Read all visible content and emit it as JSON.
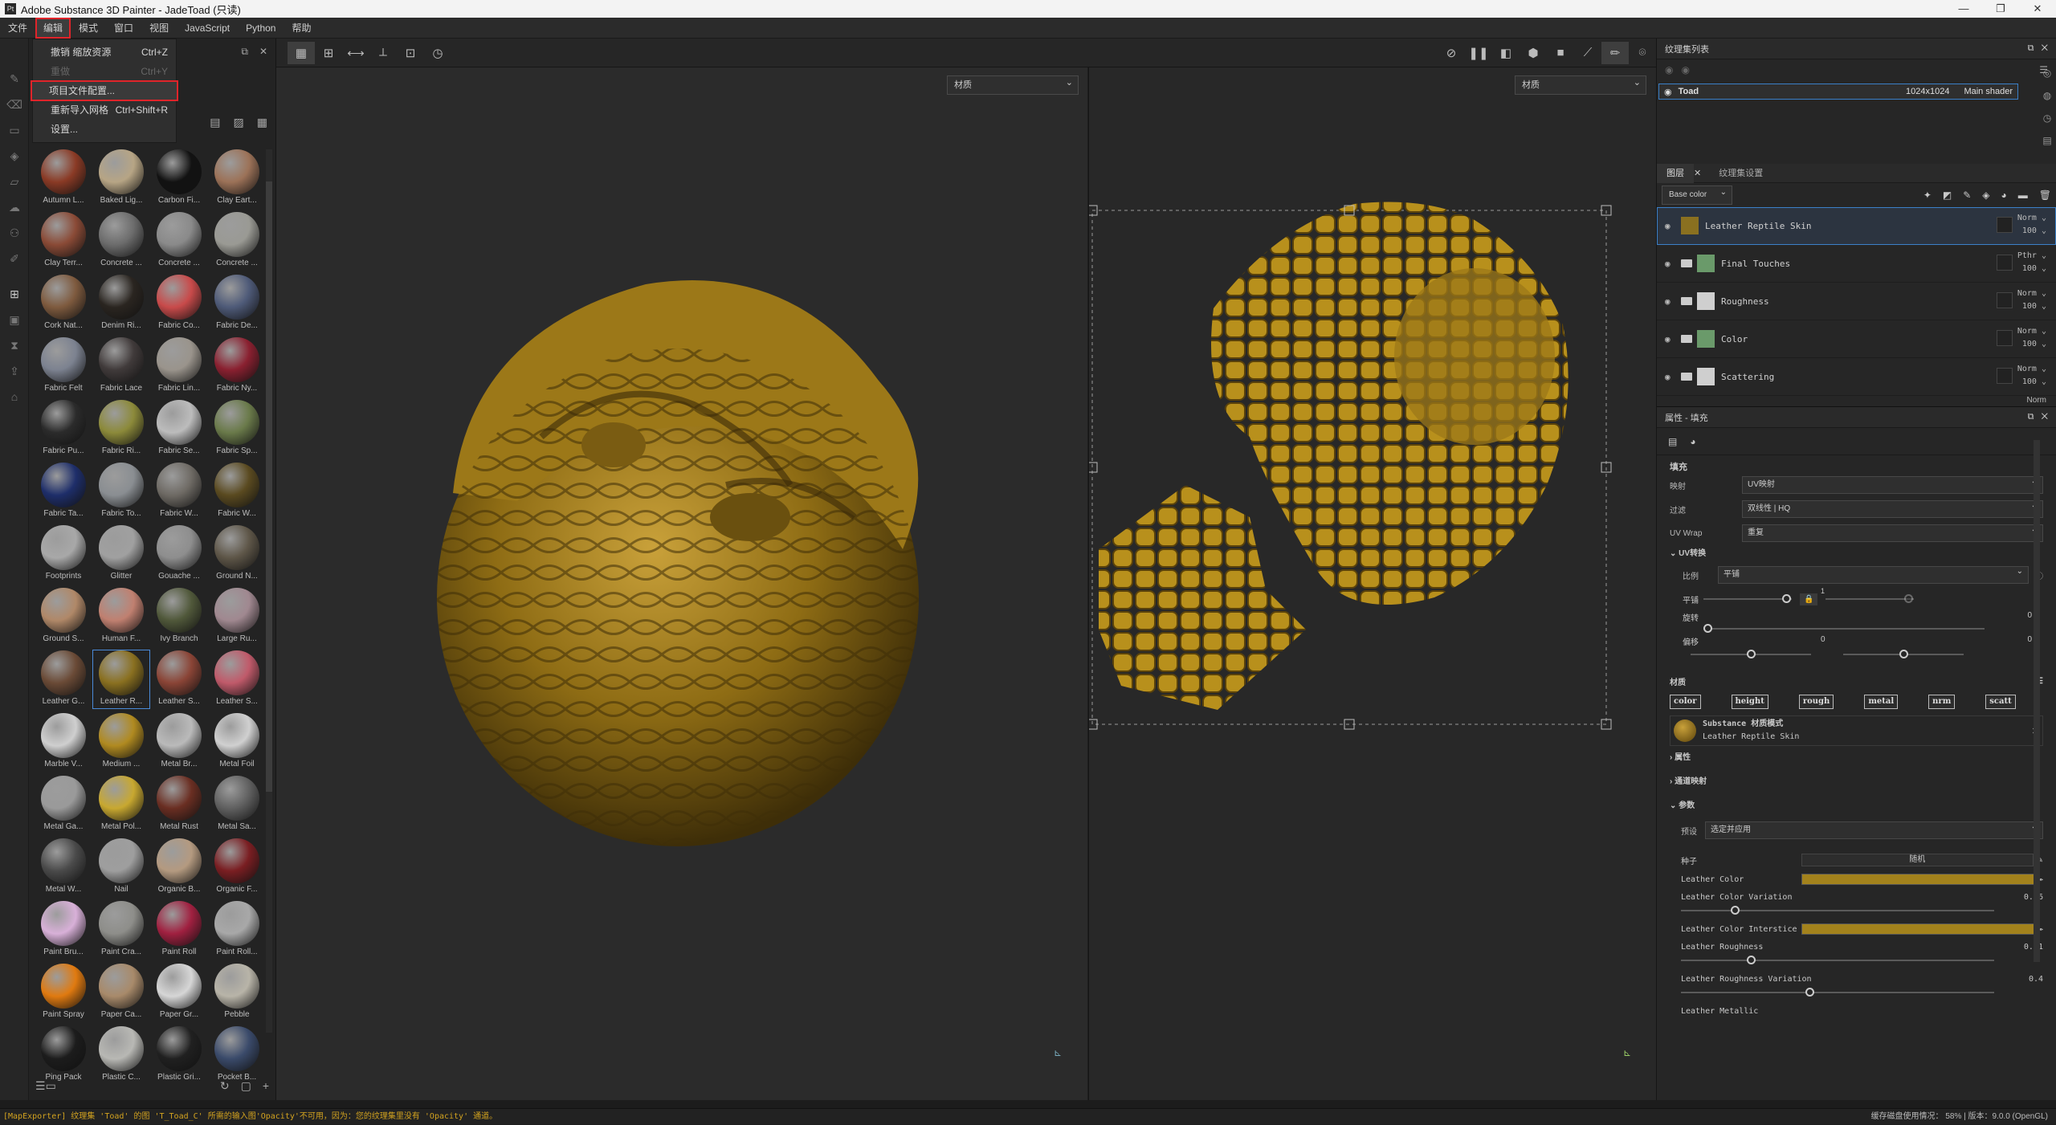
{
  "window": {
    "app_icon": "Pt",
    "title": "Adobe Substance 3D Painter - JadeToad (只读)",
    "controls": [
      "—",
      "❐",
      "✕"
    ]
  },
  "menu": [
    "文件",
    "编辑",
    "模式",
    "窗口",
    "视图",
    "JavaScript",
    "Python",
    "帮助"
  ],
  "edit_menu": [
    {
      "label": "撤销 缩放资源",
      "shortcut": "Ctrl+Z",
      "disabled": false
    },
    {
      "label": "重做",
      "shortcut": "Ctrl+Y",
      "disabled": true
    },
    {
      "label": "项目文件配置...",
      "shortcut": "",
      "disabled": false
    },
    {
      "label": "重新导入网格",
      "shortcut": "Ctrl+Shift+R",
      "disabled": false
    },
    {
      "label": "设置...",
      "shortcut": "",
      "disabled": false
    }
  ],
  "shelf": {
    "materials": [
      {
        "label": "Autumn L...",
        "color": "#8a3a25"
      },
      {
        "label": "Baked Lig...",
        "color": "#b7a585"
      },
      {
        "label": "Carbon Fi...",
        "color": "#121212"
      },
      {
        "label": "Clay Eart...",
        "color": "#9c7258"
      },
      {
        "label": "Clay Terr...",
        "color": "#8a4a36"
      },
      {
        "label": "Concrete ...",
        "color": "#6c6c6c"
      },
      {
        "label": "Concrete ...",
        "color": "#8a8a8a"
      },
      {
        "label": "Concrete ...",
        "color": "#9a9a94"
      },
      {
        "label": "Cork Nat...",
        "color": "#7e5a3e"
      },
      {
        "label": "Denim Ri...",
        "color": "#2a2520"
      },
      {
        "label": "Fabric Co...",
        "color": "#c84a4a"
      },
      {
        "label": "Fabric De...",
        "color": "#4e5a78"
      },
      {
        "label": "Fabric Felt",
        "color": "#7c8290"
      },
      {
        "label": "Fabric Lace",
        "color": "#403a3a"
      },
      {
        "label": "Fabric Lin...",
        "color": "#9a948c"
      },
      {
        "label": "Fabric Ny...",
        "color": "#8a2030"
      },
      {
        "label": "Fabric Pu...",
        "color": "#2b2b2b"
      },
      {
        "label": "Fabric Ri...",
        "color": "#8c8a3a"
      },
      {
        "label": "Fabric Se...",
        "color": "#bcbcbc"
      },
      {
        "label": "Fabric Sp...",
        "color": "#6a7a4a"
      },
      {
        "label": "Fabric Ta...",
        "color": "#1e2e6a"
      },
      {
        "label": "Fabric To...",
        "color": "#8a8e92"
      },
      {
        "label": "Fabric W...",
        "color": "#6e6a64"
      },
      {
        "label": "Fabric W...",
        "color": "#5a4a20"
      },
      {
        "label": "Footprints",
        "color": "#a8a8a8"
      },
      {
        "label": "Glitter",
        "color": "#a0a0a0"
      },
      {
        "label": "Gouache ...",
        "color": "#8e8e8e"
      },
      {
        "label": "Ground N...",
        "color": "#5e5648"
      },
      {
        "label": "Ground S...",
        "color": "#b08868"
      },
      {
        "label": "Human F...",
        "color": "#c08070"
      },
      {
        "label": "Ivy Branch",
        "color": "#50583a"
      },
      {
        "label": "Large Ru...",
        "color": "#a08890"
      },
      {
        "label": "Leather G...",
        "color": "#6a4a36"
      },
      {
        "label": "Leather R...",
        "color": "#8a7020"
      },
      {
        "label": "Leather S...",
        "color": "#8a4436"
      },
      {
        "label": "Leather S...",
        "color": "#c05a6a"
      },
      {
        "label": "Marble V...",
        "color": "#cfcfcf"
      },
      {
        "label": "Medium ...",
        "color": "#b08a20"
      },
      {
        "label": "Metal Br...",
        "color": "#bababa"
      },
      {
        "label": "Metal Foil",
        "color": "#d0d0d0"
      },
      {
        "label": "Metal Ga...",
        "color": "#9a9a9a"
      },
      {
        "label": "Metal Pol...",
        "color": "#c8a830"
      },
      {
        "label": "Metal Rust",
        "color": "#6a2e22"
      },
      {
        "label": "Metal Sa...",
        "color": "#606060"
      },
      {
        "label": "Metal W...",
        "color": "#4a4a4a"
      },
      {
        "label": "Nail",
        "color": "#9e9e9e"
      },
      {
        "label": "Organic B...",
        "color": "#b49a80"
      },
      {
        "label": "Organic F...",
        "color": "#7a1e22"
      },
      {
        "label": "Paint Bru...",
        "color": "#d8b0d8"
      },
      {
        "label": "Paint Cra...",
        "color": "#8e8e8a"
      },
      {
        "label": "Paint Roll",
        "color": "#a02040"
      },
      {
        "label": "Paint Roll...",
        "color": "#a8a8a8"
      },
      {
        "label": "Paint Spray",
        "color": "#e07a10"
      },
      {
        "label": "Paper Ca...",
        "color": "#a88a6a"
      },
      {
        "label": "Paper Gr...",
        "color": "#d6d6d6"
      },
      {
        "label": "Pebble",
        "color": "#b8b4a8"
      },
      {
        "label": "Ping Pack",
        "color": "#1c1c1c"
      },
      {
        "label": "Plastic C...",
        "color": "#b8b8b4"
      },
      {
        "label": "Plastic Gri...",
        "color": "#202020"
      },
      {
        "label": "Pocket B...",
        "color": "#3a4a6a"
      }
    ],
    "selected_index": 33
  },
  "viewport": {
    "left_select": "材质",
    "right_select": "材质"
  },
  "texture_set_list": {
    "title": "纹理集列表",
    "row": {
      "name": "Toad",
      "size": "1024x1024",
      "shader": "Main shader"
    }
  },
  "layers_panel": {
    "tabs": [
      "图层",
      "纹理集设置"
    ],
    "channel": "Base color",
    "layers": [
      {
        "name": "Leather Reptile Skin",
        "blend": "Norm",
        "opacity": "100",
        "thumb_color": "#8a7020",
        "selected": true,
        "folder": false
      },
      {
        "name": "Final Touches",
        "blend": "Pthr",
        "opacity": "100",
        "thumb_color": "#6a9a6a",
        "selected": false,
        "folder": true
      },
      {
        "name": "Roughness",
        "blend": "Norm",
        "opacity": "100",
        "thumb_color": "#cfcfcf",
        "selected": false,
        "folder": true
      },
      {
        "name": "Color",
        "blend": "Norm",
        "opacity": "100",
        "thumb_color": "#6a9a6a",
        "selected": false,
        "folder": true
      },
      {
        "name": "Scattering",
        "blend": "Norm",
        "opacity": "100",
        "thumb_color": "#cfcfcf",
        "selected": false,
        "folder": true
      }
    ],
    "partial_blend": "Norm"
  },
  "properties": {
    "title": "属性 - 填充",
    "fill_heading": "填充",
    "mapping_label": "映射",
    "mapping_value": "UV映射",
    "filter_label": "过滤",
    "filter_value": "双线性 | HQ",
    "uvwrap_label": "UV Wrap",
    "uvwrap_value": "重复",
    "uv_transform": "UV转换",
    "scale_label": "比例",
    "scale_value": "平铺",
    "tile_label": "平铺",
    "tile_value": "1",
    "rotate_label": "旋转",
    "rotate_value": "0",
    "offset_label": "偏移",
    "offset_value_a": "0",
    "offset_value_b": "0",
    "materials_heading": "材质",
    "channels": [
      "color",
      "height",
      "rough",
      "metal",
      "nrm",
      "scatt"
    ],
    "material_mode": "Substance 材质模式",
    "material_name": "Leather Reptile Skin",
    "attrs": "属性",
    "channel_map": "通道映射",
    "params": "参数",
    "preset_label": "预设",
    "preset_value": "选定并应用",
    "seed_label": "种子",
    "seed_value": "随机",
    "leather_color": "Leather Color",
    "leather_color_hex": "#a3821c",
    "leather_color_variation": "Leather Color Variation",
    "leather_color_variation_value": "0.16",
    "leather_color_interstice": "Leather Color Interstice",
    "leather_roughness": "Leather Roughness",
    "leather_roughness_value": "0.21",
    "leather_roughness_variation": "Leather Roughness Variation",
    "leather_roughness_variation_value": "0.4",
    "leather_metallic": "Leather Metallic"
  },
  "status": {
    "message": "[MapExporter] 纹理集 'Toad' 的图 'T_Toad_C' 所需的输入图'Opacity'不可用，因为：您的纹理集里没有 'Opacity' 通道。",
    "right": "缓存磁盘使用情况： 58%  |  版本：9.0.0 (OpenGL)"
  }
}
